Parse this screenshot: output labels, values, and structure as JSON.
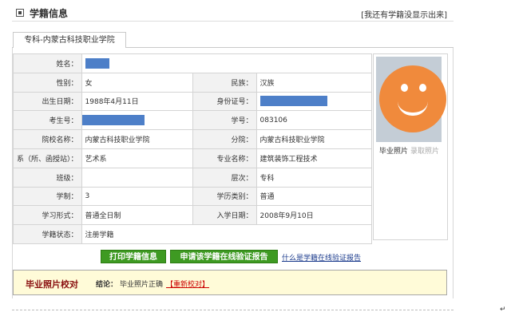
{
  "header": {
    "title": "学籍信息",
    "link": "[我还有学籍没显示出来]"
  },
  "tab": {
    "label": "专科-内蒙古科技职业学院"
  },
  "table": {
    "name_label": "姓名：",
    "gender_label": "性别：",
    "gender": "女",
    "ethnic_label": "民族：",
    "ethnic": "汉族",
    "birth_label": "出生日期：",
    "birth": "1988年4月11日",
    "id_label": "身份证号：",
    "exam_label": "考生号：",
    "studentno_label": "学号：",
    "studentno": "083106",
    "school_label": "院校名称：",
    "school": "内蒙古科技职业学院",
    "branch_label": "分院：",
    "branch": "内蒙古科技职业学院",
    "dept_label": "系（所、函授站）：",
    "dept": "艺术系",
    "major_label": "专业名称：",
    "major": "建筑装饰工程技术",
    "class_label": "班级：",
    "class": "",
    "level_label": "层次：",
    "level": "专科",
    "years_label": "学制：",
    "years": "3",
    "category_label": "学历类别：",
    "category": "普通",
    "form_label": "学习形式：",
    "form": "普通全日制",
    "enroll_label": "入学日期：",
    "enroll": "2008年9月10日",
    "status_label": "学籍状态：",
    "status": "注册学籍"
  },
  "photo": {
    "graduation_label": "毕业照片",
    "admission_label": "录取照片"
  },
  "buttons": {
    "print": "打印学籍信息",
    "verify": "申请该学籍在线验证报告",
    "what": "什么是学籍在线验证报告"
  },
  "check": {
    "title": "毕业照片校对",
    "conclusion_label": "结论：",
    "conclusion": "毕业照片正确",
    "recheck": "【重新校对】"
  },
  "colors": {
    "mask": "#4d7fc8",
    "button": "#3e9a22",
    "status": "#cc0000",
    "smiley": "#f08a3c"
  }
}
